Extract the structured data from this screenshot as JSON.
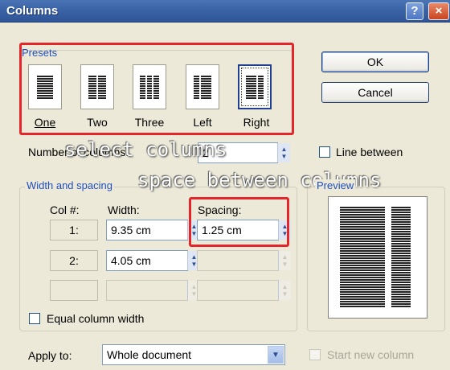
{
  "window": {
    "title": "Columns",
    "help_glyph": "?",
    "close_glyph": "×"
  },
  "presets": {
    "group_label": "Presets",
    "items": [
      {
        "label": "One",
        "key_letter_index": 0,
        "columns": 1
      },
      {
        "label": "Two",
        "key_letter_index": 1,
        "columns": 2
      },
      {
        "label": "Three",
        "key_letter_index": 0,
        "columns": 3
      },
      {
        "label": "Left",
        "key_letter_index": 0,
        "columns": 2
      },
      {
        "label": "Right",
        "key_letter_index": 0,
        "columns": 2,
        "selected": true
      }
    ]
  },
  "buttons": {
    "ok": "OK",
    "cancel": "Cancel"
  },
  "number_of_columns": {
    "label": "Number of columns:",
    "value": "2"
  },
  "line_between": {
    "label": "Line between",
    "checked": false
  },
  "width_spacing": {
    "group_label": "Width and spacing",
    "col_header": "Col #:",
    "width_header": "Width:",
    "spacing_header": "Spacing:",
    "rows": [
      {
        "col": "1:",
        "width": "9.35 cm",
        "spacing": "1.25 cm"
      },
      {
        "col": "2:",
        "width": "4.05 cm",
        "spacing": ""
      },
      {
        "col": "",
        "width": "",
        "spacing": ""
      }
    ]
  },
  "equal_width": {
    "label": "Equal column width",
    "checked": false
  },
  "preview": {
    "label": "Preview"
  },
  "apply_to": {
    "label": "Apply to:",
    "value": "Whole document"
  },
  "start_new_column": {
    "label": "Start new column",
    "checked": false
  },
  "annotations": {
    "select_columns": "select columns",
    "space_between": "space between columns"
  },
  "colors": {
    "annotation_box": "#e4252a",
    "group_label": "#1f4fbf",
    "title_bar": "#3a63a6"
  }
}
